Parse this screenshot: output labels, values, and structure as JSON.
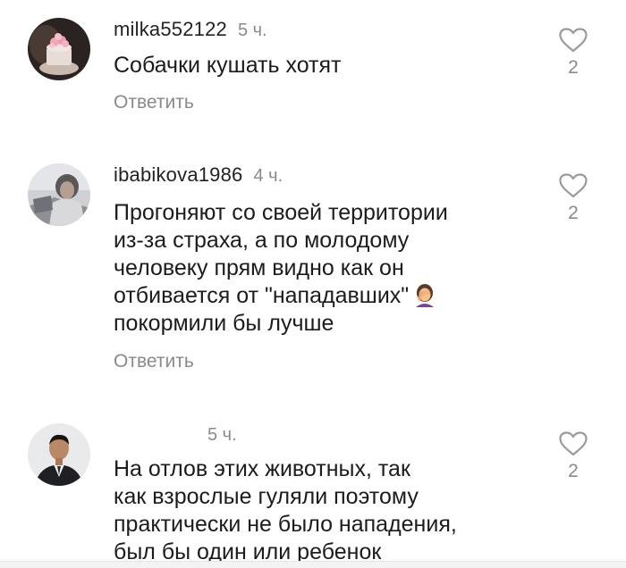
{
  "comments": [
    {
      "username": "milka552122",
      "time": "5 ч.",
      "lines": [
        "Собачки кушать хотят"
      ],
      "reply_label": "Ответить",
      "likes": "2",
      "avatar_icon": "cake-photo-avatar"
    },
    {
      "username": "ibabikova1986",
      "time": "4 ч.",
      "lines": [
        "Прогоняют со своей территории",
        "из-за страха, а по молодому",
        "человеку прям видно как он",
        "отбивается от \"нападавших\"",
        "покормили бы лучше"
      ],
      "emoji": "facepalm-emoji",
      "reply_label": "Ответить",
      "likes": "2",
      "avatar_icon": "woman-photo-avatar"
    },
    {
      "username": "",
      "time": "5 ч.",
      "lines": [
        "На отлов этих животных, так",
        "как взрослые гуляли поэтому",
        "практически не было нападения,",
        "был бы один или ребенок"
      ],
      "likes": "2",
      "avatar_icon": "man-in-suit-avatar"
    }
  ],
  "colors": {
    "text": "#1c1c1c",
    "muted": "#8a8a8a",
    "background": "#ffffff"
  }
}
